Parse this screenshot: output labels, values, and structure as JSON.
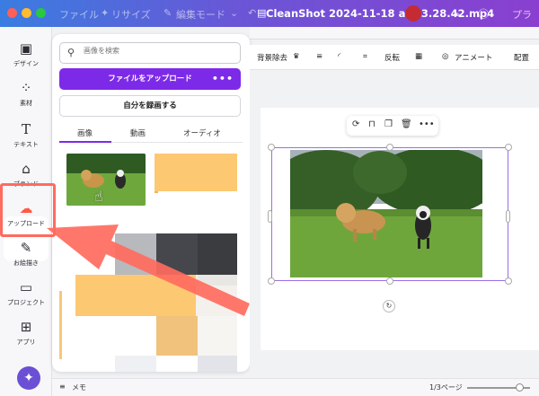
{
  "window": {
    "title": "CleanShot 2024-11-18 at 13.28.42.mp4",
    "menu_file": "ファイル",
    "menu_resize": "リサイズ",
    "menu_edit_mode": "編集モード",
    "menu_right": "プラ"
  },
  "rail": {
    "items": [
      {
        "label": "デザイン",
        "icon": "layout-icon"
      },
      {
        "label": "素材",
        "icon": "elements-icon"
      },
      {
        "label": "テキスト",
        "icon": "text-icon"
      },
      {
        "label": "ブランド",
        "icon": "brand-icon"
      },
      {
        "label": "アップロード",
        "icon": "upload-cloud-icon"
      },
      {
        "label": "お絵描き",
        "icon": "draw-icon"
      },
      {
        "label": "プロジェクト",
        "icon": "folder-icon"
      },
      {
        "label": "アプリ",
        "icon": "apps-icon"
      }
    ],
    "accent_color": "#ff5a45"
  },
  "panel": {
    "search_placeholder": "画像を検索",
    "upload_button": "ファイルをアップロード",
    "upload_more": "•••",
    "record_button": "自分を録画する",
    "tabs": [
      "画像",
      "動画",
      "オーディオ"
    ],
    "active_tab": "画像",
    "brand_purple": "#7d2ae8"
  },
  "toolbar": {
    "bg_remove": "背景除去",
    "flip": "反転",
    "animate": "アニメート",
    "position": "配置"
  },
  "footer": {
    "memo": "メモ",
    "page_indicator": "1/3ページ"
  }
}
